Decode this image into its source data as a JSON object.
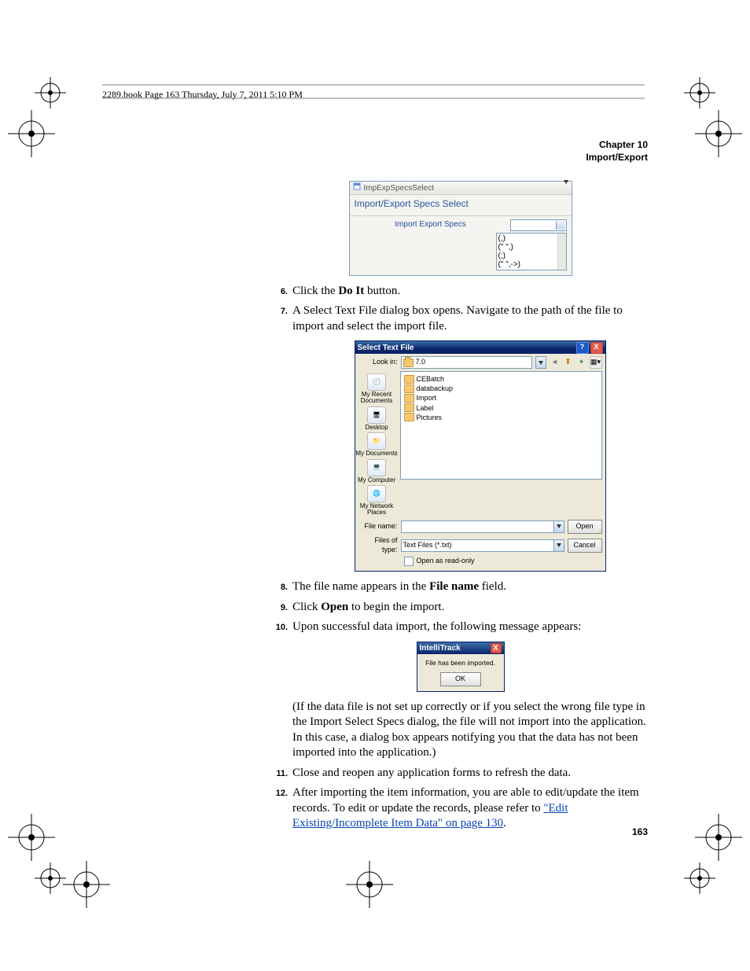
{
  "header_line": "2289.book  Page 163  Thursday, July 7, 2011  5:10 PM",
  "chapter": {
    "line1": "Chapter 10",
    "line2": "Import/Export"
  },
  "page_number": "163",
  "steps": {
    "s6": {
      "n": "6.",
      "pre": "Click the ",
      "bold": "Do It",
      "post": " button."
    },
    "s7": {
      "n": "7.",
      "text": "A Select Text File dialog box opens. Navigate to the path of the file to import and select the import file."
    },
    "s8": {
      "n": "8.",
      "pre": "The file name appears in the ",
      "bold": "File name",
      "post": " field."
    },
    "s9": {
      "n": "9.",
      "pre": "Click ",
      "bold": "Open",
      "post": " to begin the import."
    },
    "s10": {
      "n": "10.",
      "text": "Upon successful data import, the following message appears:"
    },
    "paren": "(If the data file is not set up correctly or if you select the wrong file type in the Import Select Specs dialog, the file will not import into the application. In this case, a dialog box appears notifying you that the data has not been imported into the application.)",
    "s11": {
      "n": "11.",
      "text": "Close and reopen any application forms to refresh the data."
    },
    "s12": {
      "n": "12.",
      "pre": "After importing the item information, you are able to edit/update the item records. To edit or update the records, please refer to ",
      "link": "\"Edit Existing/Incomplete Item Data\" on page 130",
      "post": "."
    }
  },
  "fig1": {
    "title": "ImpExpSpecsSelect",
    "subheader": "Import/Export Specs Select",
    "label": "Import Export Specs",
    "options": [
      "(,)",
      "(\" \",)",
      "(;)",
      "(\" \",->)"
    ]
  },
  "fig2": {
    "title": "Select Text File",
    "lookin_label": "Look in:",
    "lookin_value": "7.0",
    "places": [
      "My Recent Documents",
      "Desktop",
      "My Documents",
      "My Computer",
      "My Network Places"
    ],
    "folders": [
      "CEBatch",
      "databackup",
      "Import",
      "Label",
      "Pictures"
    ],
    "file_name_label": "File name:",
    "file_name_value": "",
    "files_of_type_label": "Files of type:",
    "files_of_type_value": "Text Files (*.txt)",
    "readonly_label": "Open as read-only",
    "open_btn": "Open",
    "cancel_btn": "Cancel",
    "help": "?",
    "close": "X"
  },
  "fig3": {
    "title": "IntelliTrack",
    "message": "File has been imported.",
    "ok": "OK",
    "close": "X"
  }
}
